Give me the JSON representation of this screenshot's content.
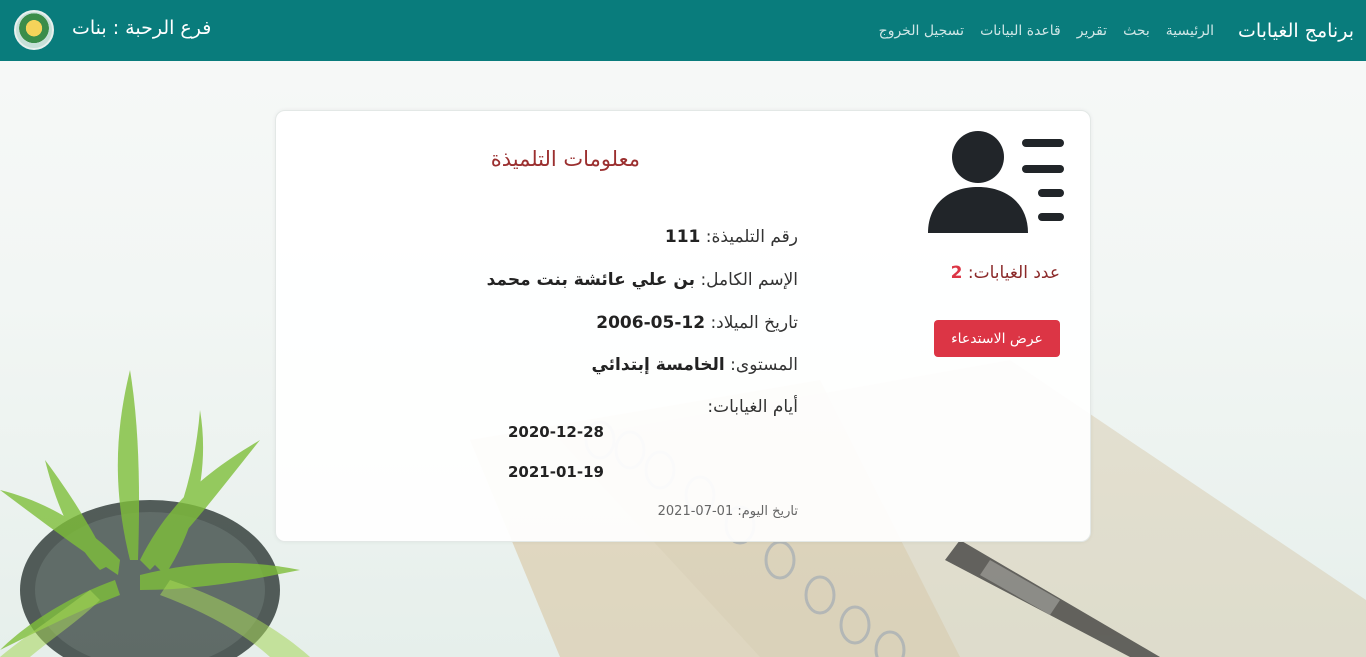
{
  "navbar": {
    "brand": "برنامج الغيابات",
    "links": [
      {
        "label": "الرئيسية"
      },
      {
        "label": "بحث"
      },
      {
        "label": "تقرير"
      },
      {
        "label": "قاعدة البيانات"
      },
      {
        "label": "تسجيل الخروج"
      }
    ],
    "branch": "فرع الرحبة : بنات",
    "color": "#097c7c"
  },
  "student_card": {
    "title": "معلومات التلميذة",
    "absence_count_label": "عدد الغيابات:",
    "absence_count": "2",
    "summons_button": "عرض الاستدعاء",
    "fields": {
      "id": {
        "label": "رقم التلميذة:",
        "value": "111"
      },
      "name": {
        "label": "الإسم الكامل:",
        "value": "بن علي عائشة بنت محمد"
      },
      "birth": {
        "label": "تاريخ الميلاد:",
        "value": "12-05-2006"
      },
      "level": {
        "label": "المستوى:",
        "value": "الخامسة إبتدائي"
      },
      "absence_days_label": "أيام الغيابات:"
    },
    "absence_days": [
      "2020-12-28",
      "2021-01-19"
    ],
    "today_label": "تاريخ اليوم:",
    "today_value": "01-07-2021",
    "accent": "#dc3545"
  }
}
